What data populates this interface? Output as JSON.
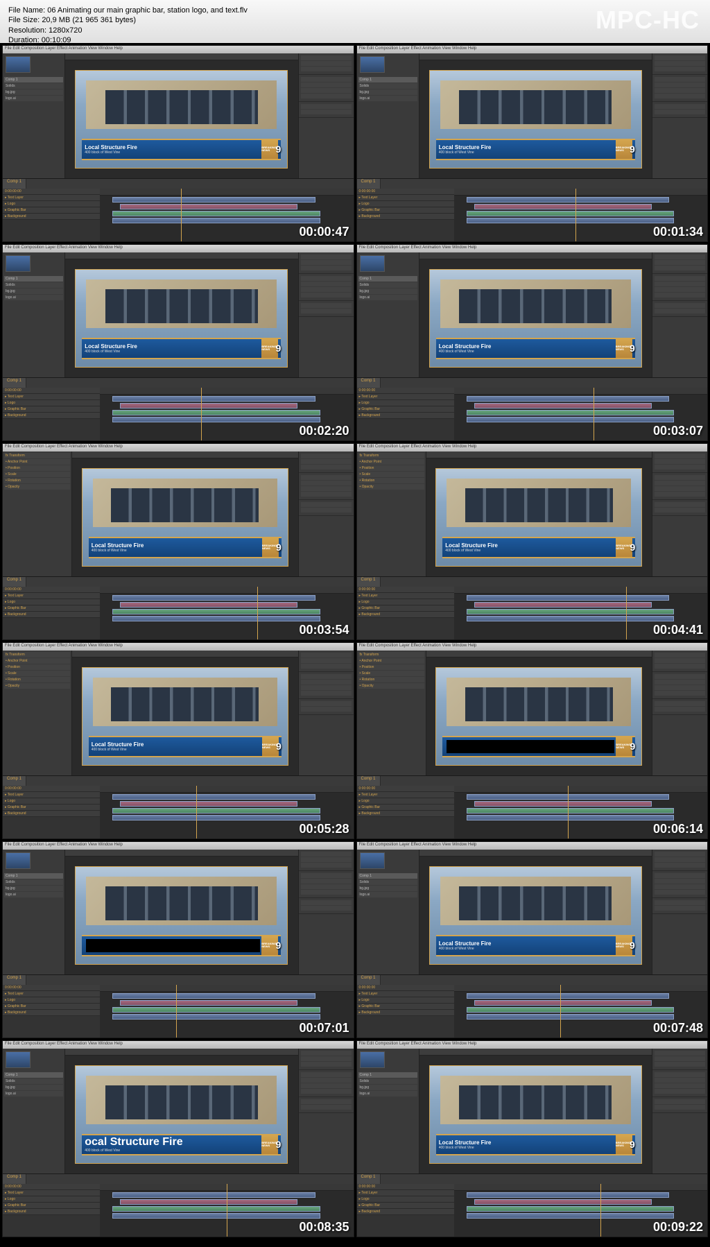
{
  "header": {
    "file_name_label": "File Name:",
    "file_name": "06 Animating our main graphic bar, station logo, and text.flv",
    "file_size_label": "File Size:",
    "file_size": "20,9 MB (21 965 361 bytes)",
    "resolution_label": "Resolution:",
    "resolution": "1280x720",
    "duration_label": "Duration:",
    "duration": "00:10:09",
    "app_logo": "MPC-HC"
  },
  "menu": "File  Edit  Composition  Layer  Effect  Animation  View  Window  Help",
  "lower_third": {
    "title": "Local Structure Fire",
    "subtitle": "400 block of West Vine",
    "badge_label": "BREAKING NEWS",
    "badge_number": "9"
  },
  "timeline_tab": "Comp 1",
  "thumbnails": [
    {
      "timestamp": "00:00:47",
      "playhead_pos": "32%",
      "show_lt_text": true
    },
    {
      "timestamp": "00:01:34",
      "playhead_pos": "48%",
      "show_lt_text": true
    },
    {
      "timestamp": "00:02:20",
      "playhead_pos": "40%",
      "show_lt_text": true
    },
    {
      "timestamp": "00:03:07",
      "playhead_pos": "55%",
      "show_lt_text": true
    },
    {
      "timestamp": "00:03:54",
      "playhead_pos": "62%",
      "show_lt_text": true,
      "mode": "effects"
    },
    {
      "timestamp": "00:04:41",
      "playhead_pos": "68%",
      "show_lt_text": true,
      "mode": "effects"
    },
    {
      "timestamp": "00:05:28",
      "playhead_pos": "38%",
      "show_lt_text": true,
      "mode": "effects"
    },
    {
      "timestamp": "00:06:14",
      "playhead_pos": "45%",
      "show_lt_text": false,
      "mode": "effects"
    },
    {
      "timestamp": "00:07:01",
      "playhead_pos": "30%",
      "show_lt_text": false
    },
    {
      "timestamp": "00:07:48",
      "playhead_pos": "42%",
      "show_lt_text": true
    },
    {
      "timestamp": "00:08:35",
      "playhead_pos": "50%",
      "show_lt_text": true,
      "mode": "big"
    },
    {
      "timestamp": "00:09:22",
      "playhead_pos": "58%",
      "show_lt_text": true
    }
  ]
}
